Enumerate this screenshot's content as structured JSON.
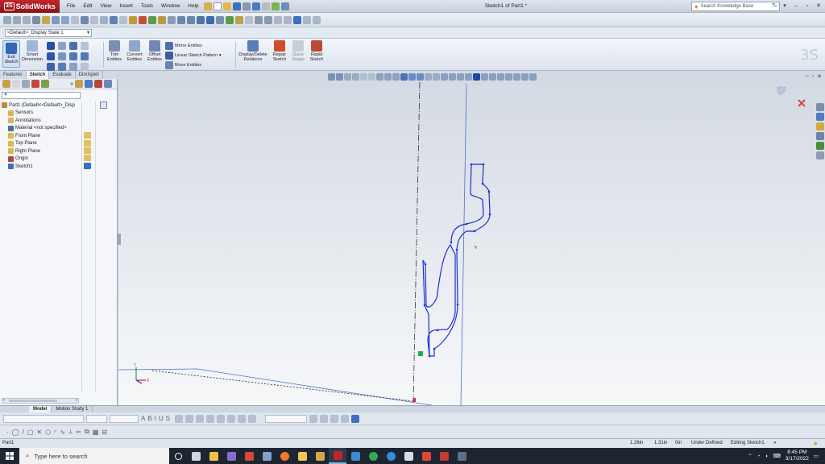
{
  "app": {
    "name": "SolidWorks",
    "window_title": "Sketch1 of Part1 *",
    "menus": [
      "File",
      "Edit",
      "View",
      "Insert",
      "Tools",
      "Window",
      "Help"
    ],
    "search_placeholder": "Search Knowledge Base",
    "window_controls": [
      "?",
      "▾",
      "–",
      "▫",
      "✕"
    ]
  },
  "config": {
    "selected": "<Default>_Display State 1"
  },
  "command_manager": {
    "exit_sketch": "Exit Sketch",
    "smart_dimension": "Smart Dimension",
    "trim_entities": "Trim Entities",
    "convert_entities": "Convert Entities",
    "offset_entities": "Offset Entities",
    "mirror_entities": "Mirror Entities",
    "linear_sketch_pattern": "Linear Sketch Pattern",
    "move_entities": "Move Entities",
    "display_delete_relations": "Display/Delete Relations",
    "repair_sketch": "Repair Sketch",
    "quick_snaps": "Quick Snaps",
    "rapid_sketch": "Rapid Sketch"
  },
  "tabs": [
    {
      "label": "Features",
      "active": false
    },
    {
      "label": "Sketch",
      "active": true
    },
    {
      "label": "Evaluate",
      "active": false
    },
    {
      "label": "DimXpert",
      "active": false
    }
  ],
  "feature_tree": [
    {
      "label": "Part1  (Default<<Default>_Disp",
      "icon": "part-icon",
      "color": "#c9873a"
    },
    {
      "label": "Sensors",
      "icon": "sensors-icon",
      "color": "#d8b35a"
    },
    {
      "label": "Annotations",
      "icon": "annotations-icon",
      "color": "#d8b35a"
    },
    {
      "label": "Material <not specified>",
      "icon": "material-icon",
      "color": "#4c6f9a"
    },
    {
      "label": "Front Plane",
      "icon": "plane-icon",
      "color": "#e0b84a"
    },
    {
      "label": "Top Plane",
      "icon": "plane-icon",
      "color": "#e0b84a"
    },
    {
      "label": "Right Plane",
      "icon": "plane-icon",
      "color": "#e0b84a"
    },
    {
      "label": "Origin",
      "icon": "origin-icon",
      "color": "#b3473c"
    },
    {
      "label": "Sketch1",
      "icon": "sketch-icon",
      "color": "#3a6fc2"
    }
  ],
  "bottom_tabs": [
    {
      "label": "Model",
      "active": true
    },
    {
      "label": "Motion Study 1",
      "active": false
    }
  ],
  "status": {
    "part": "Part1",
    "x": "1.26in",
    "y": "1.31in",
    "z": "0in",
    "definition": "Under Defined",
    "mode": "Editing Sketch1"
  },
  "taskbar": {
    "search_placeholder": "Type here to search",
    "time": "8:45 PM",
    "date": "3/17/2022"
  },
  "colors": {
    "sketch_line": "#1b2fd1",
    "brand_red": "#c0262d",
    "taskbar": "#1c2530"
  }
}
